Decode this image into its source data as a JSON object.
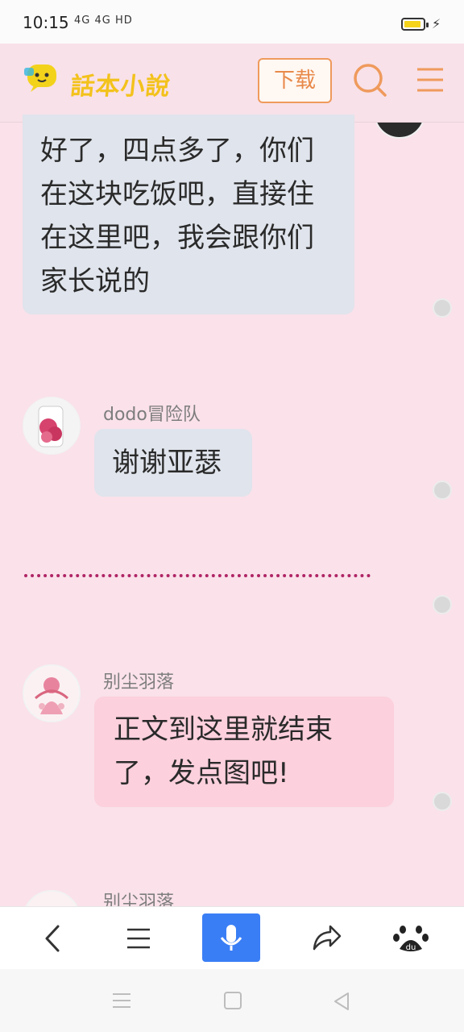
{
  "status_bar": {
    "time": "10:15",
    "network": "4G 4G HD"
  },
  "header": {
    "logo_text": "話本小說",
    "download_label": "下载"
  },
  "messages": [
    {
      "text": "好了，四点多了，你们在这块吃饭吧，直接住在这里吧，我会跟你们家长说的"
    },
    {
      "sender": "dodo冒险队",
      "text": "谢谢亚瑟"
    },
    {
      "sender": "别尘羽落",
      "text": "正文到这里就结束了，发点图吧!"
    },
    {
      "sender": "别尘羽落"
    }
  ],
  "colors": {
    "page_bg": "#fae1ea",
    "accent": "#3a7ef5",
    "divider": "#b02565",
    "header_orange": "#e8894a"
  }
}
